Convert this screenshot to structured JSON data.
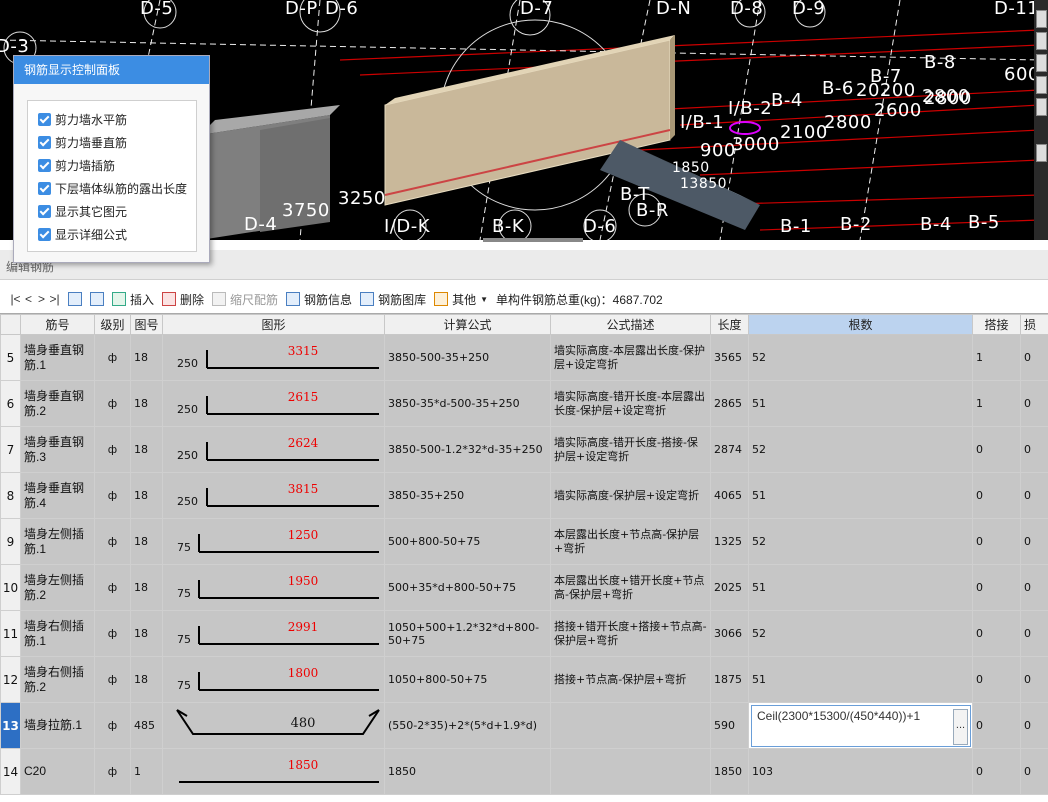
{
  "viewport": {
    "axis_labels": [
      "D-5",
      "D-P",
      "D-6",
      "D-7",
      "D-N",
      "D-8",
      "D-9",
      "D-11",
      "D-3",
      "B-7",
      "B-8",
      "B-6",
      "B-4",
      "I/B-2",
      "I/B-1",
      "B-T",
      "B-R",
      "D-4",
      "I/D-K",
      "B-K",
      "D-6",
      "B-1",
      "B-2",
      "B-4",
      "B-5",
      "600"
    ],
    "dimension_labels": [
      "20200",
      "2800",
      "900",
      "3000",
      "2100",
      "2800",
      "2600",
      "2800",
      "3750",
      "3250",
      "1850",
      "13850"
    ]
  },
  "panel": {
    "title": "钢筋显示控制面板",
    "options": [
      {
        "label": "剪力墙水平筋",
        "checked": true
      },
      {
        "label": "剪力墙垂直筋",
        "checked": true
      },
      {
        "label": "剪力墙插筋",
        "checked": true
      },
      {
        "label": "下层墙体纵筋的露出长度",
        "checked": true
      },
      {
        "label": "显示其它图元",
        "checked": true
      },
      {
        "label": "显示详细公式",
        "checked": true
      }
    ]
  },
  "section_title": "编辑钢筋",
  "toolbar": {
    "nav": [
      "|<",
      "<",
      ">",
      ">|"
    ],
    "insert": "插入",
    "delete": "删除",
    "ruler": "缩尺配筋",
    "info": "钢筋信息",
    "library": "钢筋图库",
    "other": "其他",
    "total": "单构件钢筋总重(kg)：4687.702"
  },
  "table": {
    "headers": [
      "筋号",
      "级别",
      "图号",
      "图形",
      "计算公式",
      "公式描述",
      "长度",
      "根数",
      "搭接",
      "损"
    ],
    "rows": [
      {
        "num": "5",
        "name": "墙身垂直钢筋.1",
        "grade": "ф",
        "fig": "18",
        "shape_left": "250",
        "shape_value": "3315",
        "formula": "3850-500-35+250",
        "desc": "墙实际高度-本层露出长度-保护层+设定弯折",
        "length": "3565",
        "count": "52",
        "lap": "1",
        "loss": "0"
      },
      {
        "num": "6",
        "name": "墙身垂直钢筋.2",
        "grade": "ф",
        "fig": "18",
        "shape_left": "250",
        "shape_value": "2615",
        "formula": "3850-35*d-500-35+250",
        "desc": "墙实际高度-错开长度-本层露出长度-保护层+设定弯折",
        "length": "2865",
        "count": "51",
        "lap": "1",
        "loss": "0"
      },
      {
        "num": "7",
        "name": "墙身垂直钢筋.3",
        "grade": "ф",
        "fig": "18",
        "shape_left": "250",
        "shape_value": "2624",
        "formula": "3850-500-1.2*32*d-35+250",
        "desc": "墙实际高度-错开长度-搭接-保护层+设定弯折",
        "length": "2874",
        "count": "52",
        "lap": "0",
        "loss": "0"
      },
      {
        "num": "8",
        "name": "墙身垂直钢筋.4",
        "grade": "ф",
        "fig": "18",
        "shape_left": "250",
        "shape_value": "3815",
        "formula": "3850-35+250",
        "desc": "墙实际高度-保护层+设定弯折",
        "length": "4065",
        "count": "51",
        "lap": "0",
        "loss": "0"
      },
      {
        "num": "9",
        "name": "墙身左侧插筋.1",
        "grade": "ф",
        "fig": "18",
        "shape_left": "75",
        "shape_value": "1250",
        "formula": "500+800-50+75",
        "desc": "本层露出长度+节点高-保护层+弯折",
        "length": "1325",
        "count": "52",
        "lap": "0",
        "loss": "0"
      },
      {
        "num": "10",
        "name": "墙身左侧插筋.2",
        "grade": "ф",
        "fig": "18",
        "shape_left": "75",
        "shape_value": "1950",
        "formula": "500+35*d+800-50+75",
        "desc": "本层露出长度+错开长度+节点高-保护层+弯折",
        "length": "2025",
        "count": "51",
        "lap": "0",
        "loss": "0"
      },
      {
        "num": "11",
        "name": "墙身右侧插筋.1",
        "grade": "ф",
        "fig": "18",
        "shape_left": "75",
        "shape_value": "2991",
        "formula": "1050+500+1.2*32*d+800-50+75",
        "desc": "搭接+错开长度+搭接+节点高-保护层+弯折",
        "length": "3066",
        "count": "52",
        "lap": "0",
        "loss": "0"
      },
      {
        "num": "12",
        "name": "墙身右侧插筋.2",
        "grade": "ф",
        "fig": "18",
        "shape_left": "75",
        "shape_value": "1800",
        "formula": "1050+800-50+75",
        "desc": "搭接+节点高-保护层+弯折",
        "length": "1875",
        "count": "51",
        "lap": "0",
        "loss": "0"
      },
      {
        "num": "13",
        "name": "墙身拉筋.1",
        "grade": "ф",
        "fig": "485",
        "shape_left": "",
        "shape_value": "480",
        "formula": "(550-2*35)+2*(5*d+1.9*d)",
        "desc": "",
        "length": "590",
        "count": "Ceil(2300*15300/(450*440))+1",
        "lap": "0",
        "loss": "0"
      },
      {
        "num": "14",
        "name": "C20",
        "grade": "ф",
        "fig": "1",
        "shape_left": "",
        "shape_value": "1850",
        "formula": "1850",
        "desc": "",
        "length": "1850",
        "count": "103",
        "lap": "0",
        "loss": "0"
      }
    ]
  },
  "colors": {
    "panel_header": "#3c8de3",
    "selected_header": "#bcd3ef",
    "row_bg": "#c6c6c6",
    "shape_value": "#ee0000",
    "current_row": "#2d6fc4"
  }
}
